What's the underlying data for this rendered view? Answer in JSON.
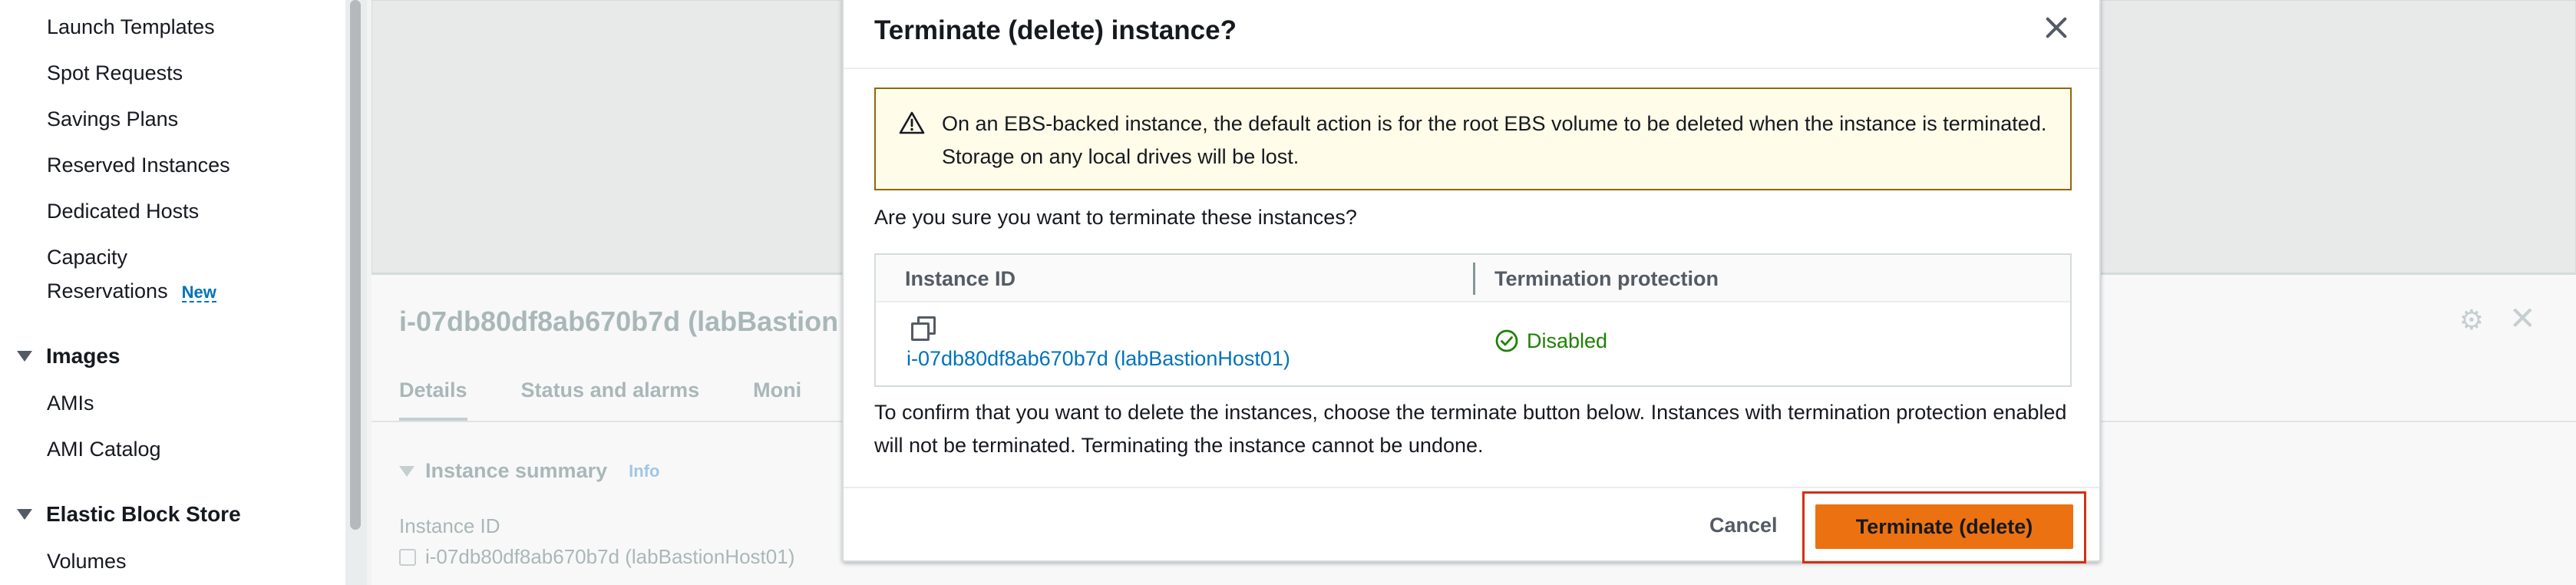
{
  "sidebar": {
    "items": [
      {
        "label": "Launch Templates"
      },
      {
        "label": "Spot Requests"
      },
      {
        "label": "Savings Plans"
      },
      {
        "label": "Reserved Instances"
      },
      {
        "label": "Dedicated Hosts"
      }
    ],
    "capacity": {
      "line1": "Capacity",
      "line2": "Reservations",
      "badge": "New"
    },
    "sections": {
      "images": {
        "label": "Images",
        "items": [
          {
            "label": "AMIs"
          },
          {
            "label": "AMI Catalog"
          }
        ]
      },
      "ebs": {
        "label": "Elastic Block Store",
        "items": [
          {
            "label": "Volumes"
          }
        ]
      }
    }
  },
  "background": {
    "title": "i-07db80df8ab670b7d (labBastion",
    "tabs": [
      "Details",
      "Status and alarms",
      "Moni"
    ],
    "summary": {
      "label": "Instance summary",
      "info": "Info"
    },
    "field_label": "Instance ID",
    "field_value": "i-07db80df8ab670b7d (labBastionHost01)",
    "gear_icon": "gear-icon",
    "close_icon": "close-icon"
  },
  "modal": {
    "title": "Terminate (delete) instance?",
    "alert": "On an EBS-backed instance, the default action is for the root EBS volume to be deleted when the instance is terminated. Storage on any local drives will be lost.",
    "question": "Are you sure you want to terminate these instances?",
    "table": {
      "columns": [
        "Instance ID",
        "Termination protection"
      ],
      "rows": [
        {
          "instance_id": "i-07db80df8ab670b7d (labBastionHost01)",
          "protection": "Disabled"
        }
      ]
    },
    "confirm_text": "To confirm that you want to delete the instances, choose the terminate button below. Instances with termination protection enabled will not be terminated. Terminating the instance cannot be undone.",
    "cancel_label": "Cancel",
    "terminate_label": "Terminate (delete)"
  },
  "colors": {
    "primary_button": "#ec7211",
    "link": "#0073bb",
    "success": "#1d8102",
    "warning_border": "#906806",
    "highlight_frame": "#d13212"
  }
}
